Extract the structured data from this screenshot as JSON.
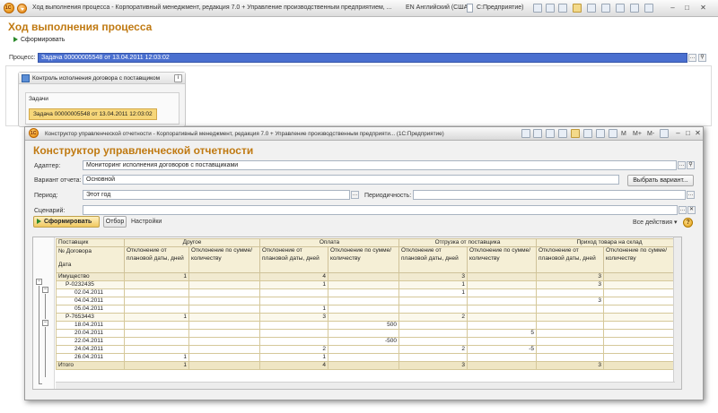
{
  "main_window": {
    "title": "Ход выполнения процесса - Корпоративный менеджмент, редакция 7.0 + Управление производственным предприятием, редакция 1.3 (1С:Предприятие)",
    "title_short": "Ход выполнения процесса - Корпоративный менеджмент, редакция 7.0 + Управление производственным предприятием, ...",
    "lang": "EN Английский (США)",
    "app": "С:Предприятие)"
  },
  "process_form": {
    "heading": "Ход выполнения процесса",
    "run_button": "Сформировать",
    "process_label": "Процесс:",
    "process_value": "Задача 00000005548 от 13.04.2011 12:03:02",
    "card_title": "Контроль исполнения договора с поставщиком",
    "tasks_label": "Задачи",
    "task_item": "Задача 00000005548 от 13.04.2011 12:03:02"
  },
  "report_window": {
    "title": "Конструктор управленческой отчетности - Корпоративный менеджмент, редакция 7.0 + Управление производственным предприяти...  (1С:Предприятие)",
    "toolbar_m": "M",
    "toolbar_mplus": "M+",
    "toolbar_mminus": "M-",
    "heading": "Конструктор управленческой отчетности",
    "adapter_label": "Адаптер:",
    "adapter_value": "Мониторинг исполнения договоров с поставщиками",
    "variant_label": "Вариант отчета:",
    "variant_value": "Основной",
    "choose_variant": "Выбрать вариант...",
    "period_label": "Период:",
    "period_value": "Этот год",
    "periodicity_label": "Периодичность:",
    "periodicity_value": "",
    "scenario_label": "Сценарий:",
    "scenario_value": "",
    "generate_button": "Сформировать",
    "filter_button": "Отбор",
    "settings_button": "Настройки",
    "all_actions": "Все действия ▾",
    "help": "?"
  },
  "report_table": {
    "row_headers": [
      "Поставщик",
      "№ Договора",
      "Дата"
    ],
    "groups": [
      "Другое",
      "Оплата",
      "Отгрузка от поставщика",
      "Приход товара на склад"
    ],
    "subcols": [
      "Отклонение от плановой даты, дней",
      "Отклонение по сумме/количеству"
    ],
    "rows": [
      {
        "label": "Имущество",
        "kind": "grp",
        "v": [
          "1",
          "",
          "4",
          "",
          "3",
          "",
          "3",
          ""
        ]
      },
      {
        "label": "Р-0232435",
        "kind": "sub",
        "v": [
          "",
          "",
          "1",
          "",
          "1",
          "",
          "3",
          ""
        ]
      },
      {
        "label": "02.04.2011",
        "kind": "item",
        "v": [
          "",
          "",
          "",
          "",
          "1",
          "",
          "",
          ""
        ]
      },
      {
        "label": "04.04.2011",
        "kind": "item",
        "v": [
          "",
          "",
          "",
          "",
          "",
          "",
          "3",
          ""
        ]
      },
      {
        "label": "05.04.2011",
        "kind": "item",
        "v": [
          "",
          "",
          "1",
          "",
          "",
          "",
          "",
          ""
        ]
      },
      {
        "label": "Р-7653443",
        "kind": "sub",
        "v": [
          "1",
          "",
          "3",
          "",
          "2",
          "",
          "",
          ""
        ]
      },
      {
        "label": "18.04.2011",
        "kind": "item",
        "v": [
          "",
          "",
          "",
          "500",
          "",
          "",
          "",
          ""
        ]
      },
      {
        "label": "20.04.2011",
        "kind": "item",
        "v": [
          "",
          "",
          "",
          "",
          "",
          "5",
          "",
          ""
        ]
      },
      {
        "label": "22.04.2011",
        "kind": "item",
        "v": [
          "",
          "",
          "",
          "-500",
          "",
          "",
          "",
          ""
        ]
      },
      {
        "label": "24.04.2011",
        "kind": "item",
        "v": [
          "",
          "",
          "2",
          "",
          "2",
          "-5",
          "",
          ""
        ]
      },
      {
        "label": "26.04.2011",
        "kind": "item",
        "v": [
          "1",
          "",
          "1",
          "",
          "",
          "",
          "",
          ""
        ]
      }
    ],
    "total": {
      "label": "Итого",
      "v": [
        "1",
        "",
        "4",
        "",
        "3",
        "",
        "3",
        ""
      ]
    }
  }
}
